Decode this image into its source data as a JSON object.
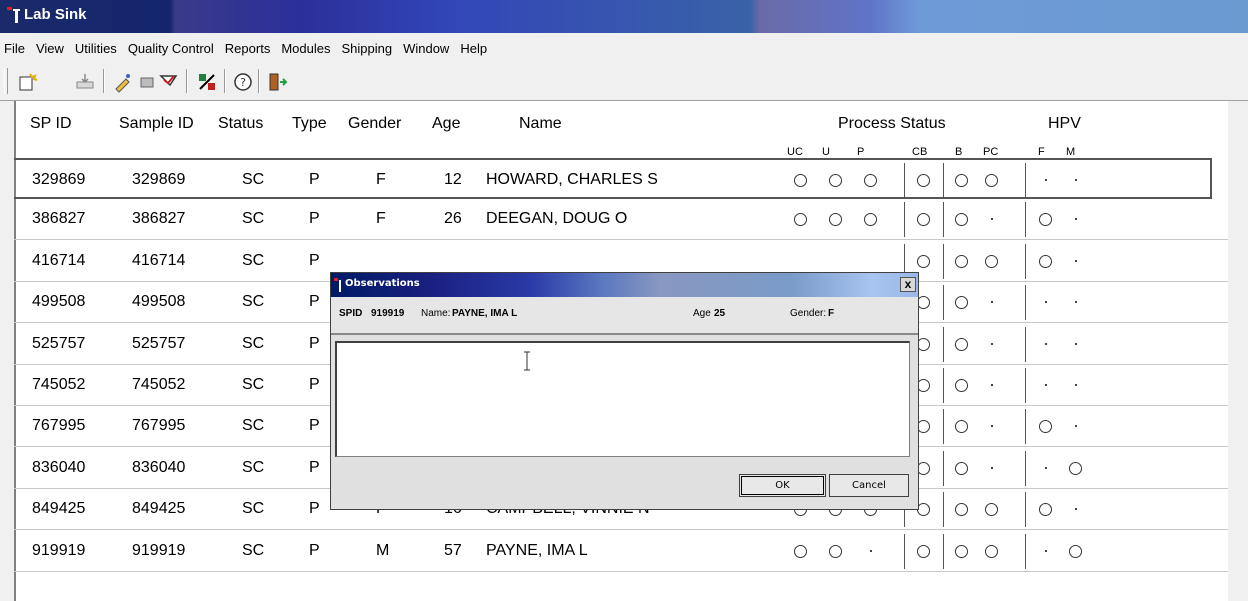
{
  "window": {
    "title": "Lab Sink"
  },
  "menu": [
    "File",
    "View",
    "Utilities",
    "Quality Control",
    "Reports",
    "Modules",
    "Shipping",
    "Window",
    "Help"
  ],
  "toolbar": {
    "icons": [
      "new-record-icon",
      "import-icon",
      "edit-icon",
      "clear-icon",
      "flag-icon",
      "tools-icon",
      "help-icon",
      "exit-icon"
    ]
  },
  "table": {
    "headers": {
      "sp_id": "SP ID",
      "sample_id": "Sample ID",
      "status": "Status",
      "type": "Type",
      "gender": "Gender",
      "age": "Age",
      "name": "Name",
      "process_status": "Process Status",
      "hpv": "HPV"
    },
    "subheaders": {
      "uc": "UC",
      "u": "U",
      "p": "P",
      "cb": "CB",
      "b": "B",
      "pc": "PC",
      "f": "F",
      "m": "M"
    },
    "rows": [
      {
        "sp_id": "329869",
        "sample_id": "329869",
        "status": "SC",
        "type": "P",
        "gender": "F",
        "age": "12",
        "name": "HOWARD, CHARLES S",
        "uc": "o",
        "u": "o",
        "p": "o",
        "cb": "o",
        "b": "o",
        "pc": "o",
        "f": "-",
        "m": "-"
      },
      {
        "sp_id": "386827",
        "sample_id": "386827",
        "status": "SC",
        "type": "P",
        "gender": "F",
        "age": "26",
        "name": "DEEGAN, DOUG O",
        "uc": "o",
        "u": "o",
        "p": "o",
        "cb": "o",
        "b": "o",
        "pc": "-",
        "f": "o",
        "m": "-"
      },
      {
        "sp_id": "416714",
        "sample_id": "416714",
        "status": "SC",
        "type": "P",
        "gender": "",
        "age": "",
        "name": "",
        "uc": "",
        "u": "",
        "p": "",
        "cb": "o",
        "b": "o",
        "pc": "o",
        "f": "o",
        "m": "-"
      },
      {
        "sp_id": "499508",
        "sample_id": "499508",
        "status": "SC",
        "type": "P",
        "gender": "",
        "age": "",
        "name": "",
        "uc": "",
        "u": "",
        "p": "",
        "cb": "o",
        "b": "o",
        "pc": "-",
        "f": "-",
        "m": "-"
      },
      {
        "sp_id": "525757",
        "sample_id": "525757",
        "status": "SC",
        "type": "P",
        "gender": "",
        "age": "",
        "name": "",
        "uc": "",
        "u": "",
        "p": "",
        "cb": "o",
        "b": "o",
        "pc": "-",
        "f": "-",
        "m": "-"
      },
      {
        "sp_id": "745052",
        "sample_id": "745052",
        "status": "SC",
        "type": "P",
        "gender": "",
        "age": "",
        "name": "",
        "uc": "",
        "u": "",
        "p": "",
        "cb": "o",
        "b": "o",
        "pc": "-",
        "f": "-",
        "m": "-"
      },
      {
        "sp_id": "767995",
        "sample_id": "767995",
        "status": "SC",
        "type": "P",
        "gender": "",
        "age": "",
        "name": "",
        "uc": "",
        "u": "",
        "p": "",
        "cb": "o",
        "b": "o",
        "pc": "-",
        "f": "o",
        "m": "-"
      },
      {
        "sp_id": "836040",
        "sample_id": "836040",
        "status": "SC",
        "type": "P",
        "gender": "",
        "age": "",
        "name": "",
        "uc": "",
        "u": "",
        "p": "",
        "cb": "o",
        "b": "o",
        "pc": "-",
        "f": "-",
        "m": "o"
      },
      {
        "sp_id": "849425",
        "sample_id": "849425",
        "status": "SC",
        "type": "P",
        "gender": "F",
        "age": "16",
        "name": "CAMPBELL, VINNIE N",
        "uc": "o",
        "u": "o",
        "p": "o",
        "cb": "o",
        "b": "o",
        "pc": "o",
        "f": "o",
        "m": "-"
      },
      {
        "sp_id": "919919",
        "sample_id": "919919",
        "status": "SC",
        "type": "P",
        "gender": "M",
        "age": "57",
        "name": "PAYNE, IMA L",
        "uc": "o",
        "u": "o",
        "p": "-",
        "cb": "o",
        "b": "o",
        "pc": "o",
        "f": "-",
        "m": "o"
      }
    ]
  },
  "dialog": {
    "title": "Observations",
    "close_label": "x",
    "spid_label": "SPID",
    "spid_value": "919919",
    "name_label": "Name:",
    "name_value": "PAYNE, IMA L",
    "age_label": "Age",
    "age_value": "25",
    "gender_label": "Gender:",
    "gender_value": "F",
    "text_value": "",
    "ok_label": "OK",
    "cancel_label": "Cancel"
  }
}
